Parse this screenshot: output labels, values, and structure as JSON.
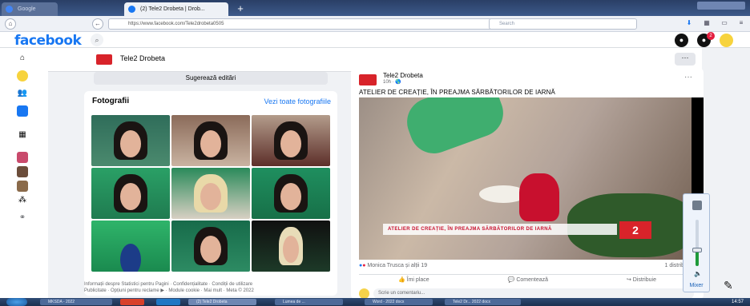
{
  "browser": {
    "tabs": [
      {
        "label": "Google"
      },
      {
        "label": "(2) Tele2 Drobeta | Drob..."
      }
    ],
    "url": "https://www.facebook.com/Tele2drobeta0505",
    "search_placeholder": "Search"
  },
  "facebook": {
    "logo": "facebook",
    "search_icon": "search-icon",
    "notification_count": "2"
  },
  "page": {
    "name": "Tele2 Drobeta",
    "more_label": "···",
    "suggest_edits": "Sugerează editări"
  },
  "photos": {
    "title": "Fotografii",
    "see_all": "Vezi toate fotografiile",
    "count": 9
  },
  "footer": {
    "line1": "Informații despre Statistici pentru Pagini · Confidențialitate · Condiții de utilizare",
    "line2": "Publicitate · Opțiuni pentru reclame ▶ · Module cookie · Mai mult · Meta © 2022"
  },
  "post": {
    "author": "Tele2 Drobeta",
    "time": "10h · 🌎",
    "text": "ATELIER DE CREAȚIE, ÎN PREAJMA SĂRBĂTORILOR DE IARNĂ",
    "banner": "ATELIER DE CREAȚIE, ÎN PREAJMA SĂRBĂTORILOR DE IARNĂ",
    "logo_text": "2",
    "reactions": "Monica Trusca și alții 19",
    "comments_count": "1 distrib",
    "like": "Îmi place",
    "comment": "Comentează",
    "share": "Distribuie",
    "comment_placeholder": "Scrie un comentariu..."
  },
  "volume": {
    "mixer_label": "Mixer",
    "level": 0.35
  },
  "taskbar": {
    "items": [
      "MKSDA - 2022",
      "",
      "",
      "(2) Tele2 Drobeta",
      "Lumea de ...",
      "Word - 2022 docx",
      "Tele2 Dr... 2022 docx"
    ],
    "clock": "14:57"
  },
  "colors": {
    "fb_blue": "#1877f2",
    "tele2_red": "#d8232a",
    "volume_green": "#1e9a3a"
  }
}
